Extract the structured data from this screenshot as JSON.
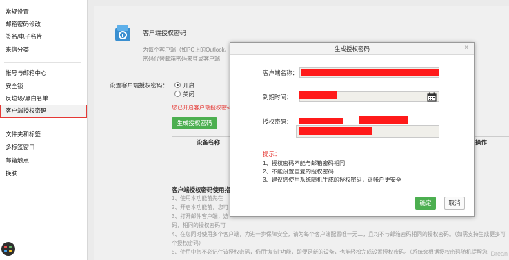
{
  "sidebar": {
    "group1": [
      "常规设置",
      "邮箱密码修改",
      "签名/电子名片",
      "来信分类"
    ],
    "group2": [
      "帐号与邮箱中心",
      "安全锁",
      "反垃圾/黑白名单",
      "客户端授权密码"
    ],
    "group3": [
      "文件夹和标签",
      "多标签窗口",
      "邮箱触点",
      "换肤"
    ]
  },
  "main": {
    "title": "客户端授权密码",
    "desc_line1": "为每个客户端（如PC上的Outlook、移动设备上的收发APP）设置专属的授权密码，用授权",
    "desc_line2": "密码代替邮箱密码来登录客户端",
    "setting_label": "设置客户端授权密码：",
    "radio_on": "开启",
    "radio_off": "关闭",
    "red_note": "您已开启客户端授权密码",
    "generate_button": "生成授权密码",
    "table_headers": [
      "设备名称",
      "操作"
    ],
    "usage_title": "客户端授权密码使用指南",
    "usage_lines": [
      "1、使用本功能前先在",
      "2、开启本功能前，您可",
      "3、打开邮件客户端，选",
      "码，相同的授权密码可",
      "4、在您同时使用多个客户端，为进一步保障安全，请为每个客户端配置唯一无二，且均不与邮箱密码相同的授权密码。（如需支持生成更多可",
      "个授权密码）",
      "5、使用中您不必记住该授权密码，仍用“复制”功能，即便是新的设备，也能轻松完成设置授权密码。（系统会根据授权密码随机提醒您"
    ]
  },
  "modal": {
    "title": "生成授权密码",
    "close": "×",
    "client_label": "客户端名称：",
    "expiry_label": "到期时间：",
    "code_label": "授权密码：",
    "tips_title": "提示：",
    "tips": [
      "1、授权密码不能与邮箱密码相同",
      "2、不能设置重复的授权密码",
      "3、建议您使用系统随机生成的授权密码，让帐户更安全"
    ],
    "ok": "确定",
    "cancel": "取消"
  },
  "watermark": "Drean",
  "colors": {
    "accent_green": "#4caf50",
    "alert_red": "#e53935",
    "redaction": "#ff1a1a"
  },
  "icons": {
    "calendar": "calendar-icon",
    "auth": "shield-key-icon",
    "app_logo": "app-logo-icon"
  }
}
